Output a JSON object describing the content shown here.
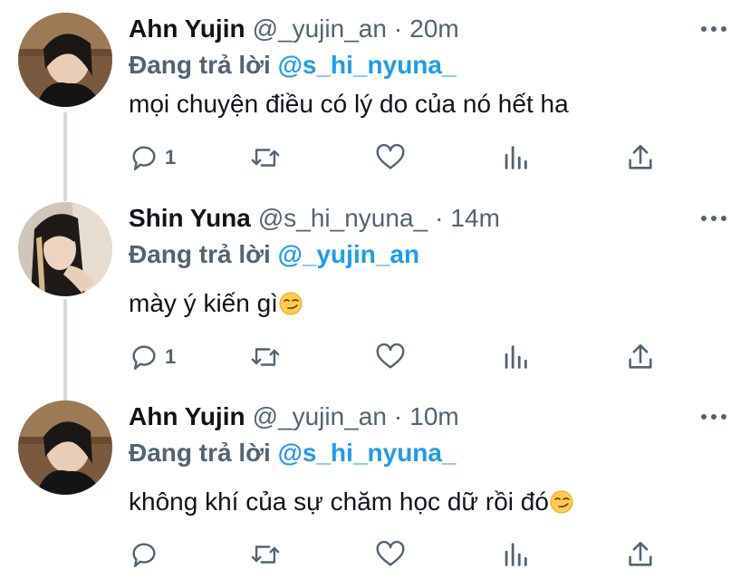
{
  "tweets": [
    {
      "name": "Ahn Yujin",
      "handle": "@_yujin_an",
      "separator": "·",
      "time": "20m",
      "reply_prefix": "Đang trả lời",
      "reply_to": "@s_hi_nyuna_",
      "text": "mọi chuyện điều có lý do của nó hết ha",
      "emoji": "",
      "reply_count": "1"
    },
    {
      "name": "Shin Yuna",
      "handle": "@s_hi_nyuna_",
      "separator": "·",
      "time": "14m",
      "reply_prefix": "Đang trả lời",
      "reply_to": "@_yujin_an",
      "text": "mày ý kiến gì",
      "emoji": "smirking-face",
      "reply_count": "1"
    },
    {
      "name": "Ahn Yujin",
      "handle": "@_yujin_an",
      "separator": "·",
      "time": "10m",
      "reply_prefix": "Đang trả lời",
      "reply_to": "@s_hi_nyuna_",
      "text": "không khí của sự chăm học dữ rồi đó",
      "emoji": "smirking-face",
      "reply_count": ""
    }
  ],
  "icons": {
    "reply": "reply-icon",
    "retweet": "retweet-icon",
    "like": "heart-icon",
    "analytics": "analytics-icon",
    "share": "share-icon",
    "more": "more-icon"
  },
  "colors": {
    "name": "#0f1419",
    "secondary": "#536471",
    "mention": "#1d9bf0",
    "thread_line": "#cfd9de"
  }
}
